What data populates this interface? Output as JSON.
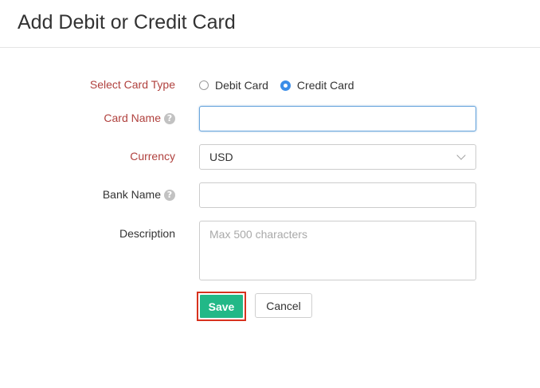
{
  "page": {
    "title": "Add Debit or Credit Card"
  },
  "form": {
    "card_type": {
      "label": "Select Card Type",
      "options": [
        {
          "label": "Debit Card",
          "checked": false
        },
        {
          "label": "Credit Card",
          "checked": true
        }
      ]
    },
    "card_name": {
      "label": "Card Name",
      "value": "",
      "help": "?"
    },
    "currency": {
      "label": "Currency",
      "value": "USD"
    },
    "bank_name": {
      "label": "Bank Name",
      "value": "",
      "help": "?"
    },
    "description": {
      "label": "Description",
      "placeholder": "Max 500 characters",
      "value": ""
    }
  },
  "actions": {
    "save_label": "Save",
    "cancel_label": "Cancel"
  },
  "colors": {
    "required_label": "#b0413e",
    "radio_selected": "#3a8de8",
    "save_button": "#22b887",
    "save_highlight": "#d7321e"
  }
}
